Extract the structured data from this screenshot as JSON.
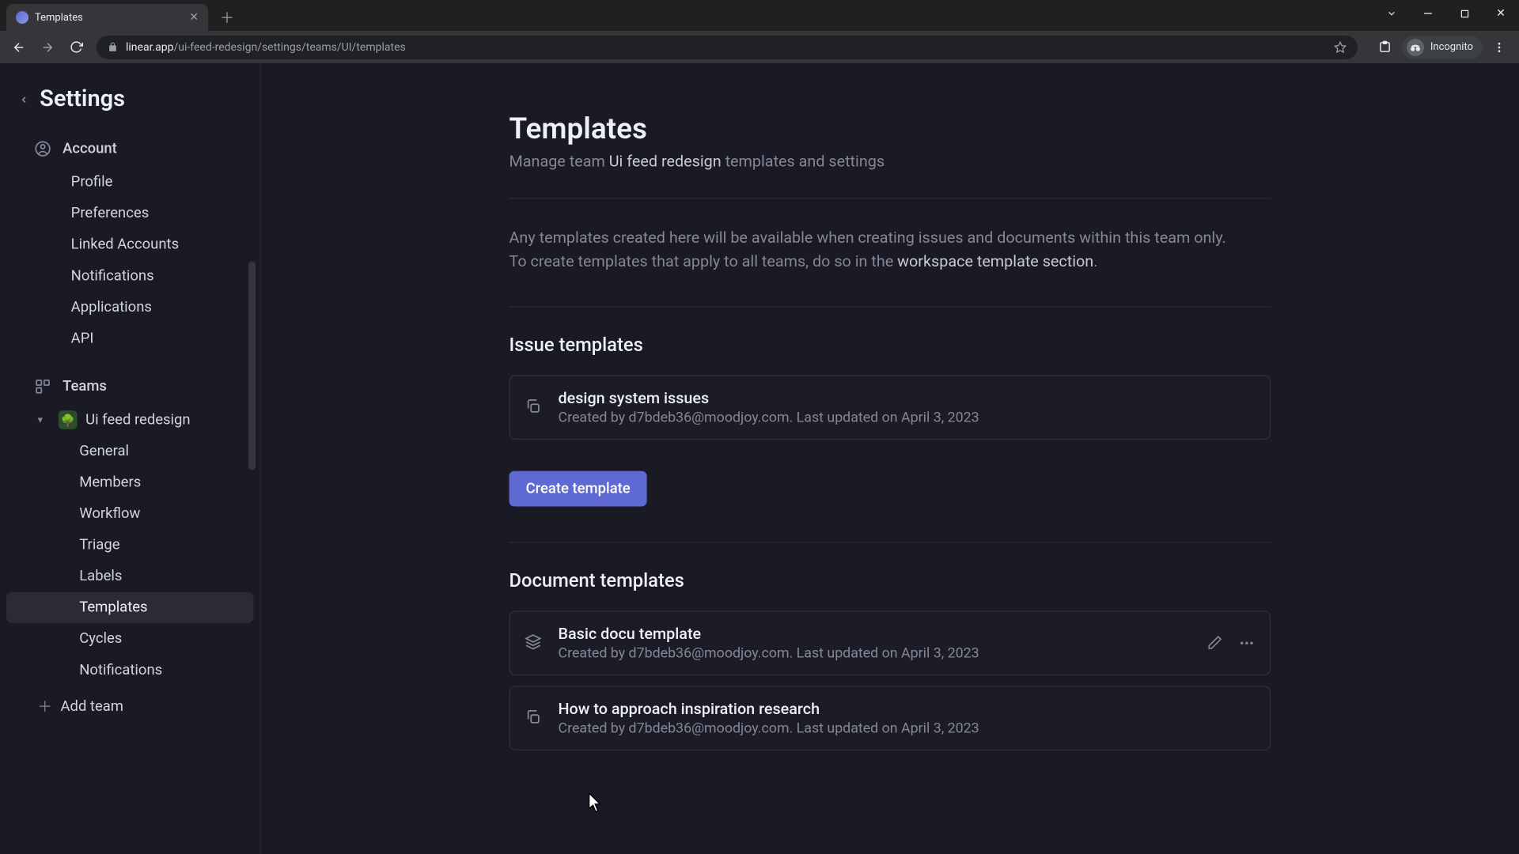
{
  "browser": {
    "tab_title": "Templates",
    "url_host": "linear.app",
    "url_path": "/ui-feed-redesign/settings/teams/UI/templates",
    "incognito_label": "Incognito"
  },
  "header": {
    "title": "Settings"
  },
  "sidebar": {
    "account_label": "Account",
    "account_items": [
      "Profile",
      "Preferences",
      "Linked Accounts",
      "Notifications",
      "Applications",
      "API"
    ],
    "teams_label": "Teams",
    "team_name": "Ui feed redesign",
    "team_items": [
      "General",
      "Members",
      "Workflow",
      "Triage",
      "Labels",
      "Templates",
      "Cycles",
      "Notifications"
    ],
    "active_team_item_index": 5,
    "add_team_label": "Add team"
  },
  "page": {
    "title": "Templates",
    "subtitle_prefix": "Manage team ",
    "subtitle_team": "Ui feed redesign",
    "subtitle_suffix": " templates and settings",
    "info_line1": "Any templates created here will be available when creating issues and documents within this team only.",
    "info_line2_prefix": "To create templates that apply to all teams, do so in the ",
    "info_link": "workspace template section",
    "info_line2_suffix": ".",
    "issue_section_title": "Issue templates",
    "document_section_title": "Document templates",
    "create_button_label": "Create template"
  },
  "issue_templates": [
    {
      "title": "design system issues",
      "meta": "Created by d7bdeb36@moodjoy.com. Last updated on April 3, 2023"
    }
  ],
  "document_templates": [
    {
      "title": "Basic docu template",
      "meta": "Created by d7bdeb36@moodjoy.com. Last updated on April 3, 2023",
      "hover": true
    },
    {
      "title": "How to approach inspiration research",
      "meta": "Created by d7bdeb36@moodjoy.com. Last updated on April 3, 2023",
      "hover": false
    }
  ]
}
